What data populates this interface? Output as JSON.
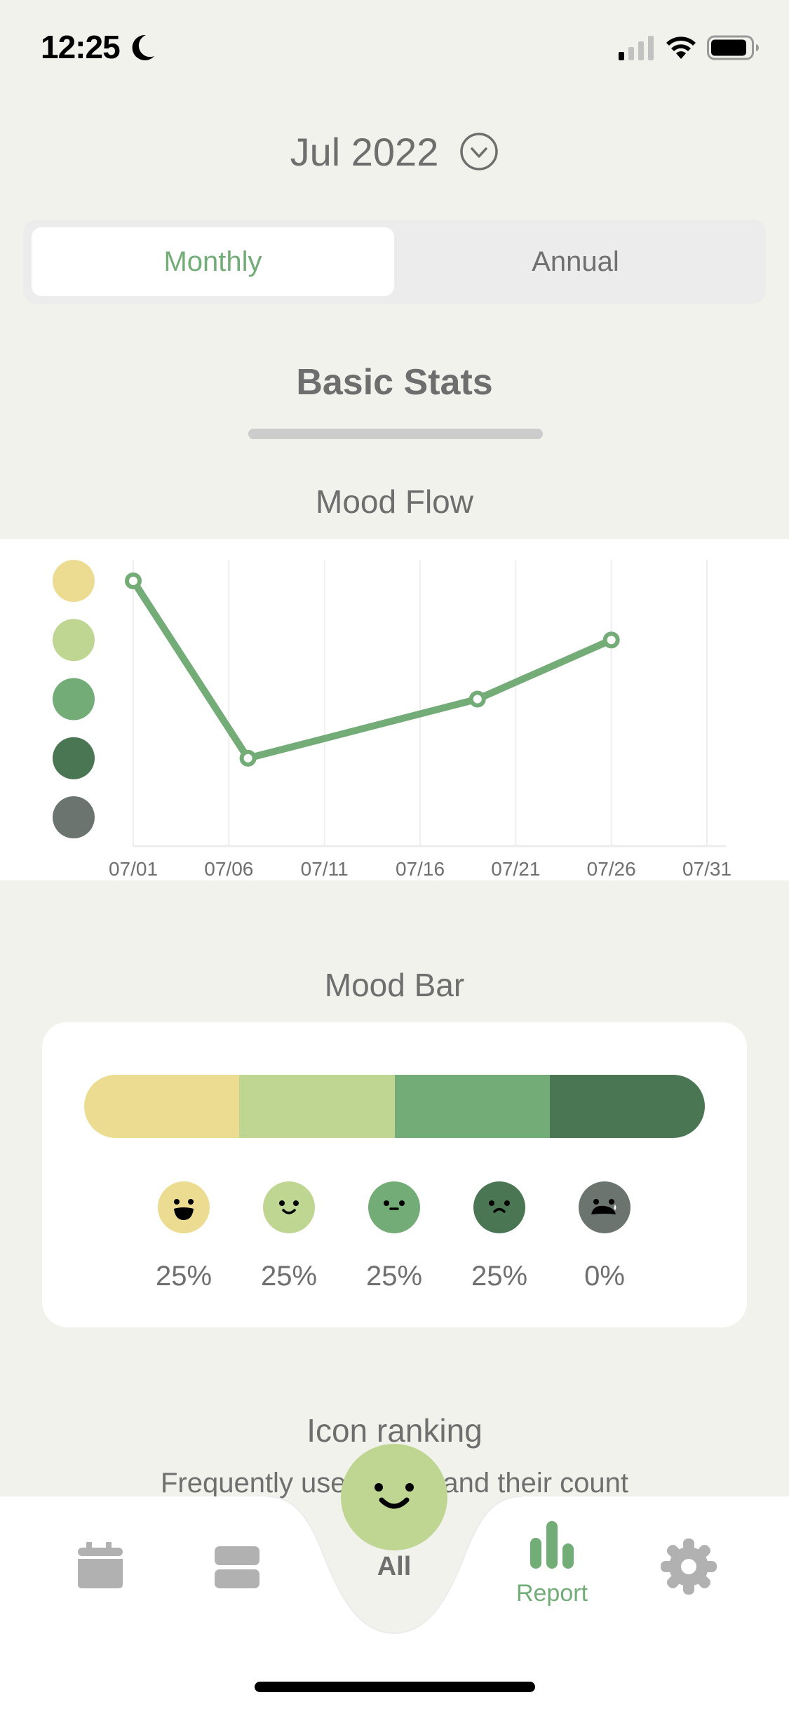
{
  "status_bar": {
    "time": "12:25",
    "icons": [
      "moon-icon",
      "cellular-signal-icon",
      "wifi-icon",
      "battery-icon"
    ]
  },
  "header": {
    "month": "Jul 2022",
    "chevron_icon": "chevron-down-circle-icon"
  },
  "segmented": {
    "options": [
      "Monthly",
      "Annual"
    ],
    "selected": "Monthly"
  },
  "section": {
    "title": "Basic Stats"
  },
  "mood_flow": {
    "title": "Mood Flow"
  },
  "mood_bar": {
    "title": "Mood Bar"
  },
  "icon_ranking": {
    "title": "Icon ranking",
    "subtitle": "Frequently used icons and their count"
  },
  "colors": {
    "mood5": "#ecdc92",
    "mood4": "#bfd693",
    "mood3": "#73ac77",
    "mood2": "#4a7653",
    "mood1": "#6c7470",
    "accent": "#72ad78",
    "background": "#f2f2ed",
    "inactive_icon": "#b1b1b1"
  },
  "moods": [
    {
      "level": 5,
      "name": "very-happy",
      "color": "#ecdc92",
      "percent": "25%"
    },
    {
      "level": 4,
      "name": "happy",
      "color": "#bfd693",
      "percent": "25%"
    },
    {
      "level": 3,
      "name": "neutral",
      "color": "#73ac77",
      "percent": "25%"
    },
    {
      "level": 2,
      "name": "sad",
      "color": "#4a7653",
      "percent": "25%"
    },
    {
      "level": 1,
      "name": "crying",
      "color": "#6c7470",
      "percent": "0%"
    }
  ],
  "chart_data": [
    {
      "type": "line",
      "title": "Mood Flow",
      "xlabel": "",
      "ylabel": "",
      "x_ticks": [
        "07/01",
        "07/06",
        "07/11",
        "07/16",
        "07/21",
        "07/26",
        "07/31"
      ],
      "xlim": [
        1,
        31
      ],
      "ylim": [
        1,
        5
      ],
      "y_ticks": [
        "mood5",
        "mood4",
        "mood3",
        "mood2",
        "mood1"
      ],
      "grid": "vertical",
      "series": [
        {
          "name": "mood",
          "color": "#73ac77",
          "points": [
            {
              "date": "07/01",
              "day": 1,
              "value": 5
            },
            {
              "date": "07/07",
              "day": 7,
              "value": 2
            },
            {
              "date": "07/19",
              "day": 19,
              "value": 3
            },
            {
              "date": "07/26",
              "day": 26,
              "value": 4
            }
          ]
        }
      ]
    },
    {
      "type": "bar",
      "title": "Mood Bar",
      "orientation": "stacked-horizontal",
      "categories": [
        "mood5",
        "mood4",
        "mood3",
        "mood2",
        "mood1"
      ],
      "values": [
        25,
        25,
        25,
        25,
        0
      ],
      "unit": "%"
    }
  ],
  "tab_bar": {
    "items": [
      {
        "id": "calendar",
        "icon": "calendar-icon",
        "label": ""
      },
      {
        "id": "list",
        "icon": "list-icon",
        "label": ""
      },
      {
        "id": "all",
        "icon": "happy-face-icon",
        "label": "All"
      },
      {
        "id": "report",
        "icon": "bar-chart-icon",
        "label": "Report",
        "active": true
      },
      {
        "id": "settings",
        "icon": "gear-icon",
        "label": ""
      }
    ]
  }
}
